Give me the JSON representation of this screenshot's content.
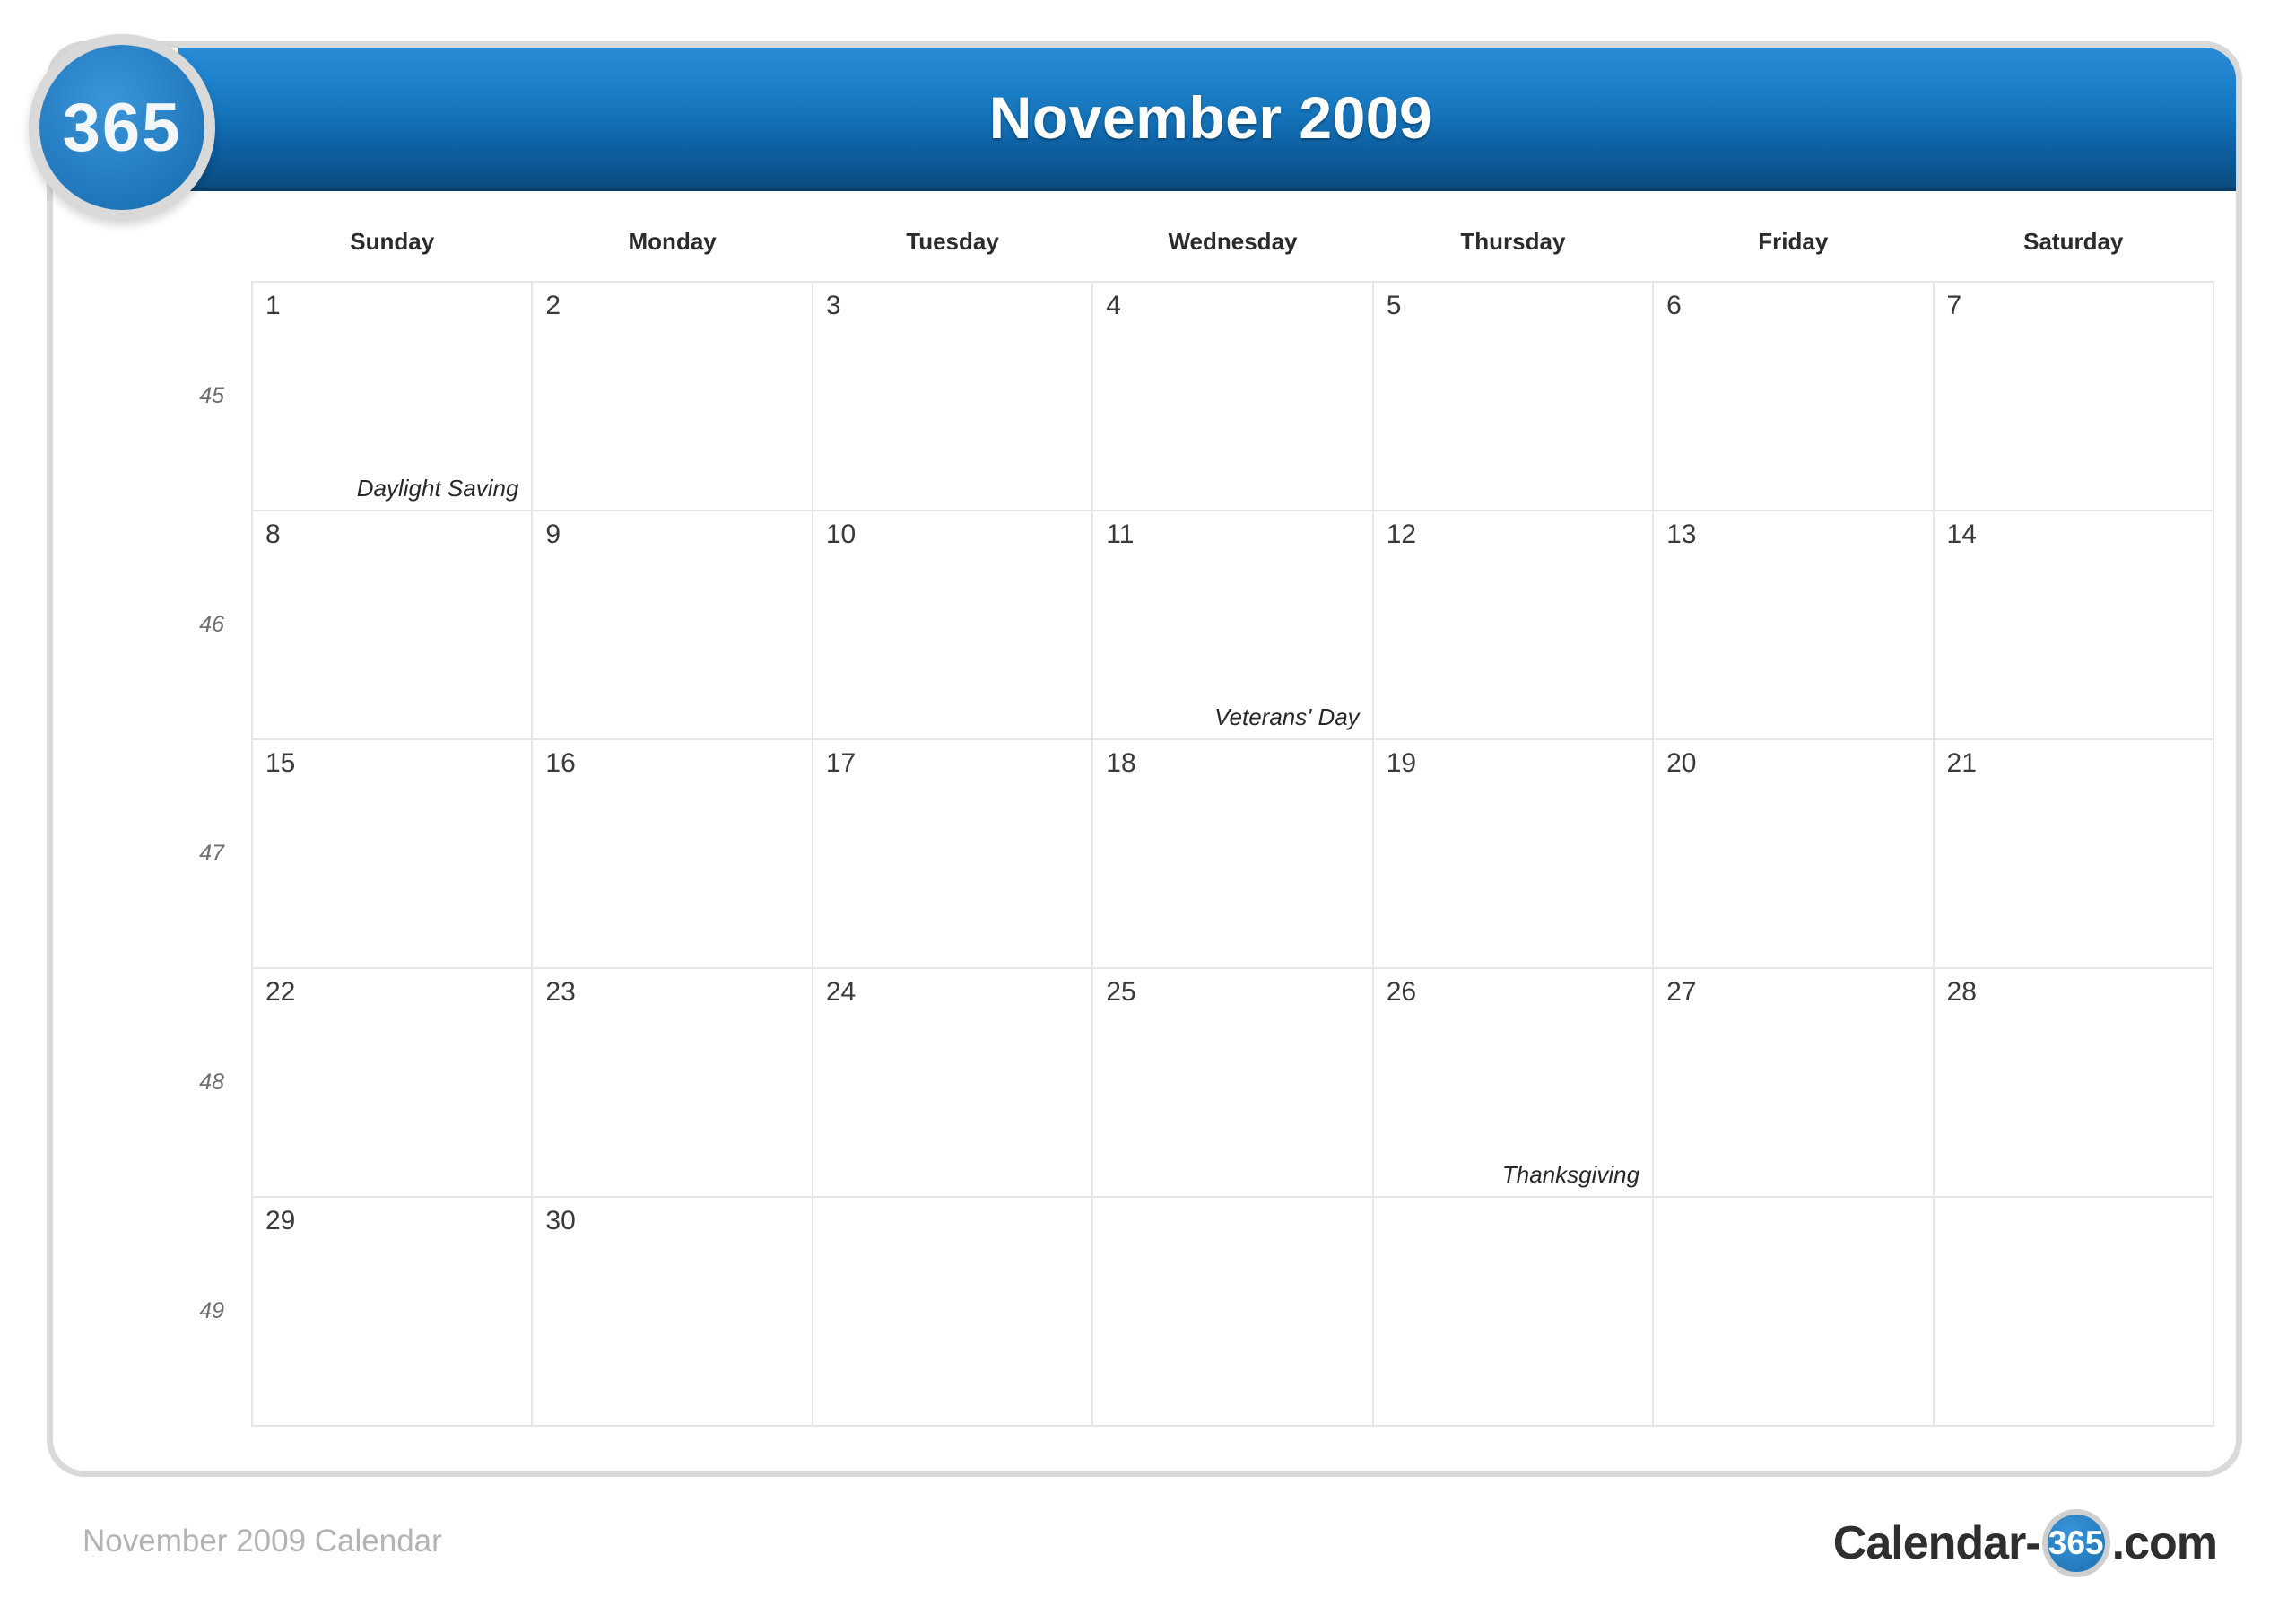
{
  "logo": {
    "text": "365",
    "name": "365-logo"
  },
  "header": {
    "title": "November 2009"
  },
  "watermark": {
    "text": "365"
  },
  "weekday_headers": [
    "Sunday",
    "Monday",
    "Tuesday",
    "Wednesday",
    "Thursday",
    "Friday",
    "Saturday"
  ],
  "week_numbers": [
    "45",
    "46",
    "47",
    "48",
    "49"
  ],
  "weeks": [
    {
      "week": "45",
      "days": [
        {
          "num": "1",
          "event": "Daylight Saving",
          "highlight": true,
          "weekend": true,
          "empty": false
        },
        {
          "num": "2",
          "event": "",
          "highlight": false,
          "weekend": false,
          "empty": false
        },
        {
          "num": "3",
          "event": "",
          "highlight": false,
          "weekend": false,
          "empty": false
        },
        {
          "num": "4",
          "event": "",
          "highlight": false,
          "weekend": false,
          "empty": false
        },
        {
          "num": "5",
          "event": "",
          "highlight": false,
          "weekend": false,
          "empty": false
        },
        {
          "num": "6",
          "event": "",
          "highlight": false,
          "weekend": false,
          "empty": false
        },
        {
          "num": "7",
          "event": "",
          "highlight": false,
          "weekend": true,
          "empty": false
        }
      ]
    },
    {
      "week": "46",
      "days": [
        {
          "num": "8",
          "event": "",
          "highlight": false,
          "weekend": true,
          "empty": false
        },
        {
          "num": "9",
          "event": "",
          "highlight": false,
          "weekend": false,
          "empty": false
        },
        {
          "num": "10",
          "event": "",
          "highlight": false,
          "weekend": false,
          "empty": false
        },
        {
          "num": "11",
          "event": "Veterans' Day",
          "highlight": true,
          "weekend": false,
          "empty": false
        },
        {
          "num": "12",
          "event": "",
          "highlight": false,
          "weekend": false,
          "empty": false
        },
        {
          "num": "13",
          "event": "",
          "highlight": false,
          "weekend": false,
          "empty": false
        },
        {
          "num": "14",
          "event": "",
          "highlight": false,
          "weekend": true,
          "empty": false
        }
      ]
    },
    {
      "week": "47",
      "days": [
        {
          "num": "15",
          "event": "",
          "highlight": false,
          "weekend": true,
          "empty": false
        },
        {
          "num": "16",
          "event": "",
          "highlight": false,
          "weekend": false,
          "empty": false
        },
        {
          "num": "17",
          "event": "",
          "highlight": false,
          "weekend": false,
          "empty": false
        },
        {
          "num": "18",
          "event": "",
          "highlight": false,
          "weekend": false,
          "empty": false
        },
        {
          "num": "19",
          "event": "",
          "highlight": false,
          "weekend": false,
          "empty": false
        },
        {
          "num": "20",
          "event": "",
          "highlight": false,
          "weekend": false,
          "empty": false
        },
        {
          "num": "21",
          "event": "",
          "highlight": false,
          "weekend": true,
          "empty": false
        }
      ]
    },
    {
      "week": "48",
      "days": [
        {
          "num": "22",
          "event": "",
          "highlight": false,
          "weekend": true,
          "empty": false
        },
        {
          "num": "23",
          "event": "",
          "highlight": false,
          "weekend": false,
          "empty": false
        },
        {
          "num": "24",
          "event": "",
          "highlight": false,
          "weekend": false,
          "empty": false
        },
        {
          "num": "25",
          "event": "",
          "highlight": false,
          "weekend": false,
          "empty": false
        },
        {
          "num": "26",
          "event": "Thanksgiving",
          "highlight": true,
          "weekend": false,
          "empty": false
        },
        {
          "num": "27",
          "event": "",
          "highlight": false,
          "weekend": false,
          "empty": false
        },
        {
          "num": "28",
          "event": "",
          "highlight": false,
          "weekend": true,
          "empty": false
        }
      ]
    },
    {
      "week": "49",
      "days": [
        {
          "num": "29",
          "event": "",
          "highlight": false,
          "weekend": true,
          "empty": false
        },
        {
          "num": "30",
          "event": "",
          "highlight": false,
          "weekend": false,
          "empty": false
        },
        {
          "num": "",
          "event": "",
          "highlight": false,
          "weekend": false,
          "empty": true
        },
        {
          "num": "",
          "event": "",
          "highlight": false,
          "weekend": false,
          "empty": true
        },
        {
          "num": "",
          "event": "",
          "highlight": false,
          "weekend": false,
          "empty": true
        },
        {
          "num": "",
          "event": "",
          "highlight": false,
          "weekend": false,
          "empty": true
        },
        {
          "num": "",
          "event": "",
          "highlight": false,
          "weekend": true,
          "empty": true
        }
      ]
    }
  ],
  "footer": {
    "label": "November 2009 Calendar",
    "brand_prefix": "Calendar-",
    "brand_badge": "365",
    "brand_suffix": ".com"
  },
  "colors": {
    "header_top": "#2a8ad6",
    "header_bottom": "#0b4a7c",
    "holiday_bg": "#d4e8fa",
    "weekend_bg": "#efefef",
    "grid_line": "#e6e6e6",
    "card_border": "#d9d9d9",
    "footer_label": "#b3b3b3"
  }
}
